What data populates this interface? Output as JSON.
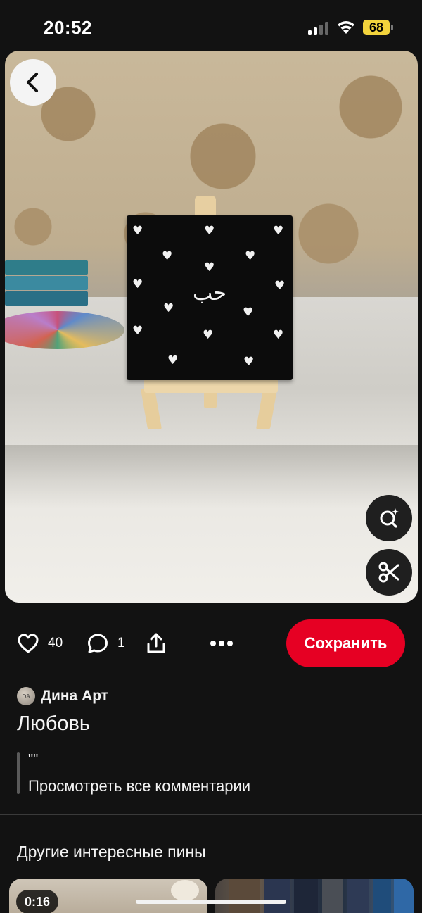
{
  "status_bar": {
    "time": "20:52",
    "battery": "68"
  },
  "pin": {
    "canvas_text": "حب",
    "likes": "40",
    "comments": "1",
    "save_label": "Сохранить",
    "author_initials": "DA",
    "author_name": "Дина Арт",
    "title": "Любовь",
    "description": "\"\"",
    "view_comments_label": "Просмотреть все комментарии"
  },
  "more_pins": {
    "title": "Другие интересные пины",
    "first_duration": "0:16"
  },
  "colors": {
    "accent": "#e60023",
    "background": "#121212",
    "battery": "#f2d33c"
  },
  "icons": [
    "back-icon",
    "visual-search-icon",
    "scissors-icon",
    "heart-icon",
    "comment-icon",
    "share-icon",
    "more-icon"
  ]
}
